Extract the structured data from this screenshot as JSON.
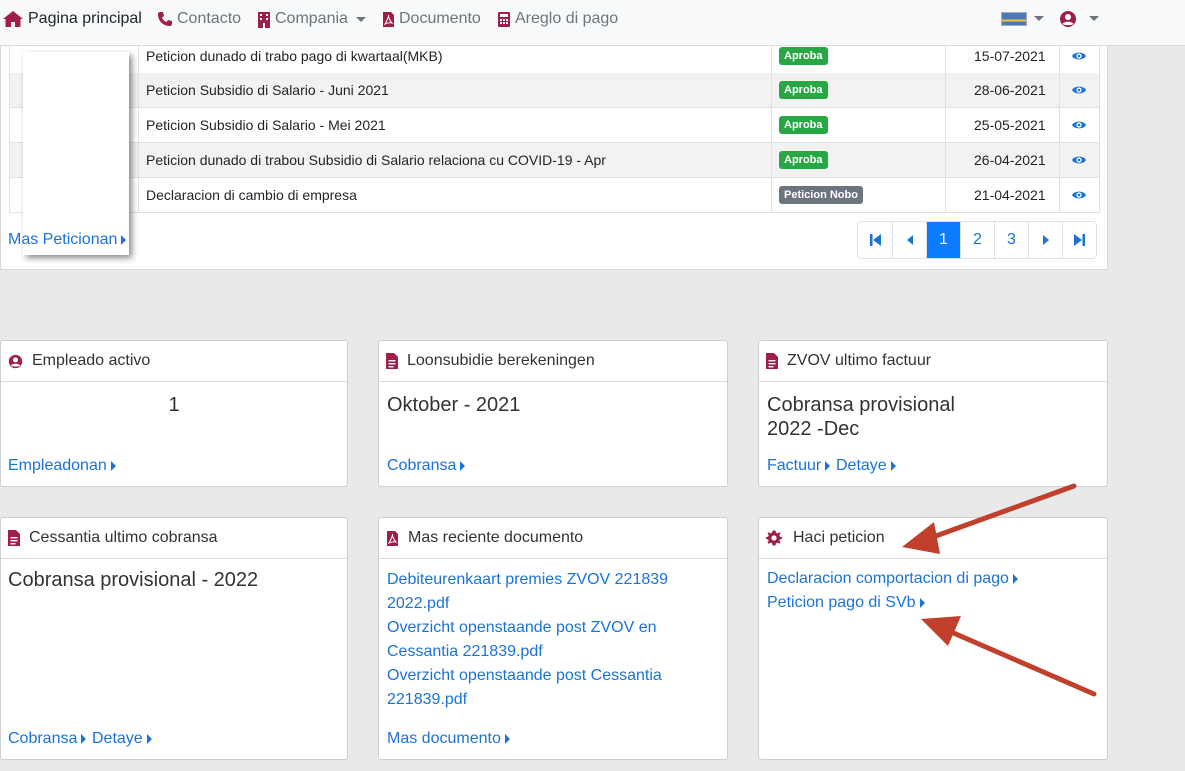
{
  "nav": {
    "home": "Pagina principal",
    "contact": "Contacto",
    "company": "Compania",
    "document": "Documento",
    "payment": "Areglo di pago"
  },
  "table": {
    "rows": [
      {
        "title": "Peticion dunado di trabo pago di kwartaal(MKB)",
        "status": "Aproba",
        "date": "15-07-2021"
      },
      {
        "title": "Peticion Subsidio di Salario - Juni 2021",
        "status": "Aproba",
        "date": "28-06-2021"
      },
      {
        "title": "Peticion Subsidio di Salario - Mei 2021",
        "status": "Aproba",
        "date": "25-05-2021"
      },
      {
        "title": "Peticion dunado di trabou Subsidio di Salario relaciona cu COVID-19 - Apr",
        "status": "Aproba",
        "date": "26-04-2021"
      },
      {
        "title": "Declaracion di cambio di empresa",
        "status": "Peticion Nobo",
        "date": "21-04-2021"
      }
    ],
    "more_link": "Mas Peticionan",
    "pages": [
      "1",
      "2",
      "3"
    ],
    "active_page": "1"
  },
  "cards": {
    "empleado": {
      "title": "Empleado activo",
      "value": "1",
      "link": "Empleadonan"
    },
    "loonsubidie": {
      "title": "Loonsubidie berekeningen",
      "value": "Oktober - 2021",
      "link": "Cobransa"
    },
    "zvov": {
      "title": "ZVOV ultimo factuur",
      "value_line1": "Cobransa provisional",
      "value_line2": "2022 -Dec",
      "link1": "Factuur",
      "link2": "Detaye"
    },
    "cessantia": {
      "title": "Cessantia ultimo cobransa",
      "value": "Cobransa provisional - 2022",
      "link1": "Cobransa",
      "link2": "Detaye"
    },
    "documento": {
      "title": "Mas reciente documento",
      "docs": [
        "Debiteurenkaart premies ZVOV 221839",
        "2022.pdf",
        "Overzicht openstaande post ZVOV en",
        "Cessantia 221839.pdf",
        "Overzicht openstaande post Cessantia",
        "221839.pdf"
      ],
      "link": "Mas documento"
    },
    "haci": {
      "title": "Haci peticion",
      "link1": "Declaracion comportacion di pago",
      "link2": "Peticion pago di SVb"
    }
  },
  "colors": {
    "accent": "#a01e4a",
    "link": "#1a73d9",
    "primary": "#0b7bff",
    "approved": "#28a745",
    "new": "#6c757d",
    "arrow": "#c0402c"
  }
}
